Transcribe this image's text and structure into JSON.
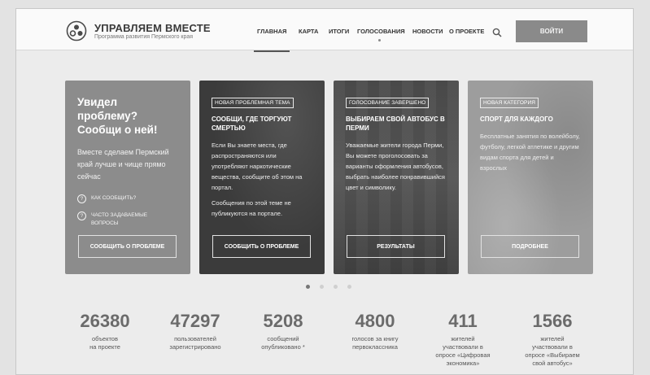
{
  "header": {
    "brand_title": "УПРАВЛЯЕМ ВМЕСТЕ",
    "brand_subtitle": "Программа развития Пермского края",
    "nav": [
      {
        "label": "ГЛАВНАЯ",
        "active": true
      },
      {
        "label": "КАРТА"
      },
      {
        "label": "ИТОГИ"
      },
      {
        "label": "ГОЛОСОВАНИЯ"
      },
      {
        "label": "НОВОСТИ"
      },
      {
        "label": "О ПРОЕКТЕ"
      }
    ],
    "search_icon": "search-icon",
    "login_label": "ВОЙТИ"
  },
  "intro_card": {
    "title_line1": "Увидел проблему?",
    "title_line2": "Сообщи о ней!",
    "text": "Вместе сделаем Пермский край лучше и чище прямо сейчас",
    "link1": "КАК СООБЩИТЬ?",
    "link2_line1": "ЧАСТО ЗАДАВАЕМЫЕ",
    "link2_line2": "ВОПРОСЫ",
    "button": "СООБЩИТЬ О ПРОБЛЕМЕ"
  },
  "cards": [
    {
      "badge": "НОВАЯ ПРОБЛЕМНАЯ ТЕМА",
      "title": "СООБЩИ, ГДЕ ТОРГУЮТ СМЕРТЬЮ",
      "text1": "Если Вы знаете места, где распространяются или употребляют наркотические вещества, сообщите об этом на портал.",
      "text2": "Сообщения по этой теме не публикуются на портале.",
      "button": "СООБЩИТЬ О ПРОБЛЕМЕ"
    },
    {
      "badge": "ГОЛОСОВАНИЕ ЗАВЕРШЕНО",
      "title": "ВЫБИРАЕМ СВОЙ АВТОБУС В ПЕРМИ",
      "text1": "Уважаемые жители города Перми, Вы можете проголосовать за варианты оформления автобусов, выбрать наиболее понравившийся цвет и символику.",
      "text2": "",
      "button": "РЕЗУЛЬТАТЫ"
    },
    {
      "badge": "НОВАЯ КАТЕГОРИЯ",
      "title": "СПОРТ ДЛЯ КАЖДОГО",
      "text1": "Бесплатные занятия по волейболу, футболу, легкой атлетике и другим видам спорта для детей и взрослых",
      "text2": "",
      "button": "ПОДРОБНЕЕ"
    }
  ],
  "carousel": {
    "count": 4,
    "active": 0
  },
  "stats": [
    {
      "number": "26380",
      "l1": "объектов",
      "l2": "на проекте",
      "l3": "",
      "l4": ""
    },
    {
      "number": "47297",
      "l1": "пользователей",
      "l2": "зарегистрировано",
      "l3": "",
      "l4": ""
    },
    {
      "number": "5208",
      "l1": "сообщений",
      "l2": "опубликовано *",
      "l3": "",
      "l4": ""
    },
    {
      "number": "4800",
      "l1": "голосов за книгу",
      "l2": "первоклассника",
      "l3": "",
      "l4": ""
    },
    {
      "number": "411",
      "l1": "жителей",
      "l2": "участвовали в",
      "l3": "опросе «Цифровая",
      "l4": "экономика»"
    },
    {
      "number": "1566",
      "l1": "жителей",
      "l2": "участвовали в",
      "l3": "опросе «Выбираем",
      "l4": "свой автобус»"
    }
  ]
}
